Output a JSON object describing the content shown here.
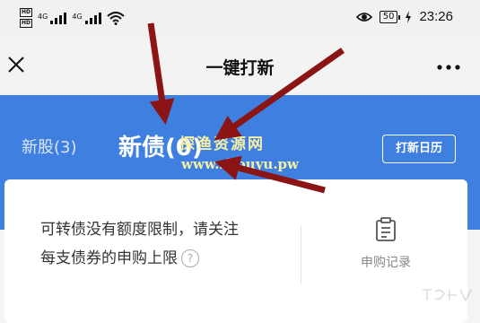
{
  "status_bar": {
    "sim1": "HD",
    "sim2": "HD",
    "net1": "4G",
    "net2": "4G",
    "battery": "50",
    "time": "23:26"
  },
  "title_bar": {
    "close_icon": "close-icon",
    "title": "一键打新",
    "more_icon": "more-icon"
  },
  "header": {
    "tabs": [
      {
        "label": "新股(3)"
      },
      {
        "label": "新债(0)"
      }
    ],
    "calendar_button": "打新日历"
  },
  "watermark": {
    "line1": "探渔资源网",
    "line2": "www.shouyu.pw"
  },
  "card": {
    "line1": "可转债没有额度限制，请关注",
    "line2": "每支债券的申购上限",
    "help_icon": "?",
    "record_label": "申购记录"
  },
  "colors": {
    "brand_blue": "#3f7fe0",
    "arrow_red": "#8b1414",
    "watermark_yellow": "#f5f0a6"
  }
}
